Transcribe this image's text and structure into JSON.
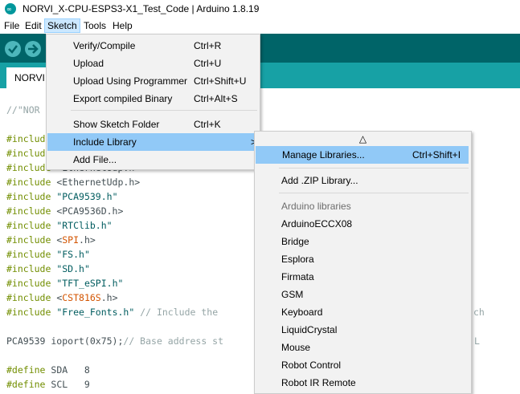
{
  "window": {
    "title": "NORVI_X-CPU-ESPS3-X1_Test_Code | Arduino 1.8.19"
  },
  "menubar": {
    "items": [
      "File",
      "Edit",
      "Sketch",
      "Tools",
      "Help"
    ],
    "active": "Sketch"
  },
  "toolbar": {
    "buttons": [
      {
        "name": "verify",
        "icon": "check-icon"
      },
      {
        "name": "upload",
        "icon": "arrow-right-icon"
      }
    ]
  },
  "tabs": [
    {
      "label": "NORVI"
    }
  ],
  "editor": {
    "lines": [
      {
        "segs": [
          {
            "t": "//\"NOR",
            "c": "cmt"
          }
        ]
      },
      {
        "segs": []
      },
      {
        "segs": [
          {
            "t": "#include",
            "c": "kw"
          }
        ]
      },
      {
        "segs": [
          {
            "t": "#include",
            "c": "kw"
          }
        ]
      },
      {
        "segs": [
          {
            "t": "#include",
            "c": "kw"
          },
          {
            "t": " <EthernetUdp.h>",
            "c": ""
          }
        ]
      },
      {
        "segs": [
          {
            "t": "#include",
            "c": "kw"
          },
          {
            "t": " <EthernetUdp.h>",
            "c": ""
          }
        ]
      },
      {
        "segs": [
          {
            "t": "#include",
            "c": "kw"
          },
          {
            "t": " ",
            "c": ""
          },
          {
            "t": "\"PCA9539.h\"",
            "c": "str"
          }
        ]
      },
      {
        "segs": [
          {
            "t": "#include",
            "c": "kw"
          },
          {
            "t": " <PCA9536D.h>",
            "c": ""
          }
        ]
      },
      {
        "segs": [
          {
            "t": "#include",
            "c": "kw"
          },
          {
            "t": " ",
            "c": ""
          },
          {
            "t": "\"RTClib.h\"",
            "c": "str"
          }
        ]
      },
      {
        "segs": [
          {
            "t": "#include",
            "c": "kw"
          },
          {
            "t": " <",
            "c": ""
          },
          {
            "t": "SPI",
            "c": "lib"
          },
          {
            "t": ".h>",
            "c": ""
          }
        ]
      },
      {
        "segs": [
          {
            "t": "#include",
            "c": "kw"
          },
          {
            "t": " ",
            "c": ""
          },
          {
            "t": "\"FS.h\"",
            "c": "str"
          }
        ]
      },
      {
        "segs": [
          {
            "t": "#include",
            "c": "kw"
          },
          {
            "t": " ",
            "c": ""
          },
          {
            "t": "\"SD.h\"",
            "c": "str"
          }
        ]
      },
      {
        "segs": [
          {
            "t": "#include",
            "c": "kw"
          },
          {
            "t": " ",
            "c": ""
          },
          {
            "t": "\"TFT_eSPI.h\"",
            "c": "str"
          }
        ]
      },
      {
        "segs": [
          {
            "t": "#include",
            "c": "kw"
          },
          {
            "t": " <",
            "c": ""
          },
          {
            "t": "CST816S",
            "c": "lib"
          },
          {
            "t": ".h>",
            "c": ""
          }
        ]
      },
      {
        "segs": [
          {
            "t": "#include",
            "c": "kw"
          },
          {
            "t": " ",
            "c": ""
          },
          {
            "t": "\"Free_Fonts.h\"",
            "c": "str"
          },
          {
            "t": " // Include the",
            "c": "cmt"
          }
        ]
      },
      {
        "segs": []
      },
      {
        "segs": [
          {
            "t": "PCA9539 ioport(0x75);",
            "c": ""
          },
          {
            "t": "// Base address st",
            "c": "cmt"
          }
        ]
      },
      {
        "segs": []
      },
      {
        "segs": [
          {
            "t": "#define",
            "c": "kw"
          },
          {
            "t": " SDA   8",
            "c": ""
          }
        ]
      },
      {
        "segs": [
          {
            "t": "#define",
            "c": "kw"
          },
          {
            "t": " SCL   9",
            "c": ""
          }
        ]
      }
    ],
    "tail_fragments": [
      {
        "text": "ch",
        "line": 14
      },
      {
        "text": "L",
        "line": 16
      }
    ]
  },
  "sketch_menu": {
    "items": [
      {
        "label": "Verify/Compile",
        "shortcut": "Ctrl+R"
      },
      {
        "label": "Upload",
        "shortcut": "Ctrl+U"
      },
      {
        "label": "Upload Using Programmer",
        "shortcut": "Ctrl+Shift+U"
      },
      {
        "label": "Export compiled Binary",
        "shortcut": "Ctrl+Alt+S"
      },
      {
        "label": "Show Sketch Folder",
        "shortcut": "Ctrl+K"
      },
      {
        "label": "Include Library",
        "shortcut": "",
        "submenu_arrow": ">",
        "highlighted": true
      },
      {
        "label": "Add File...",
        "shortcut": ""
      }
    ]
  },
  "include_library_menu": {
    "scroll_up_arrow": "△",
    "manage": {
      "label": "Manage Libraries...",
      "shortcut": "Ctrl+Shift+I",
      "highlighted": true
    },
    "add_zip": "Add .ZIP Library...",
    "section_header": "Arduino libraries",
    "libraries": [
      "ArduinoECCX08",
      "Bridge",
      "Esplora",
      "Firmata",
      "GSM",
      "Keyboard",
      "LiquidCrystal",
      "Mouse",
      "Robot Control",
      "Robot IR Remote"
    ]
  },
  "colors": {
    "toolbar": "#006468",
    "tabbar": "#17a1a5",
    "highlight": "#91c9f7",
    "menu_bg": "#f2f2f2"
  }
}
